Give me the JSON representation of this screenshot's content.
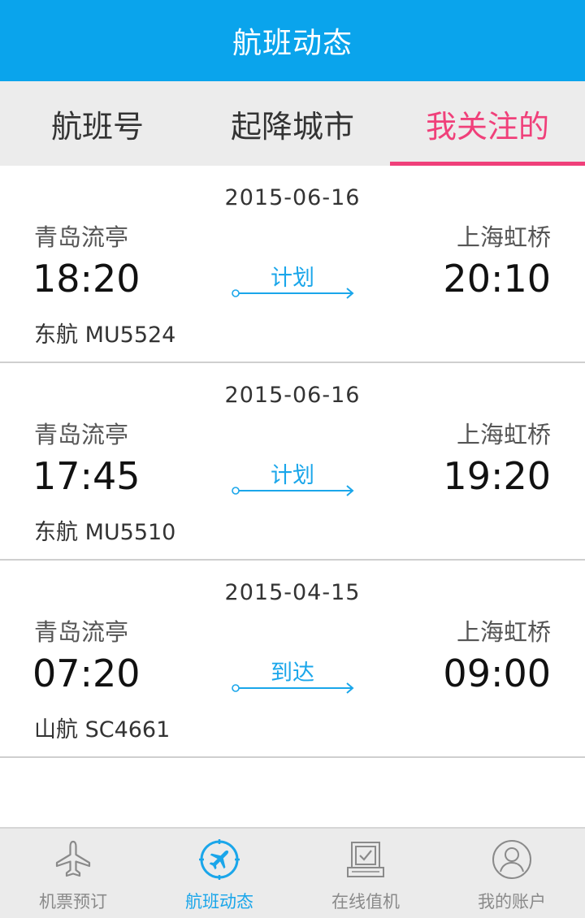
{
  "header": {
    "title": "航班动态"
  },
  "tabs": [
    {
      "label": "航班号",
      "active": false
    },
    {
      "label": "起降城市",
      "active": false
    },
    {
      "label": "我关注的",
      "active": true
    }
  ],
  "flights": [
    {
      "date": "2015-06-16",
      "from": "青岛流亭",
      "to": "上海虹桥",
      "dep": "18:20",
      "arr": "20:10",
      "status": "计划",
      "airline": "东航 MU5524"
    },
    {
      "date": "2015-06-16",
      "from": "青岛流亭",
      "to": "上海虹桥",
      "dep": "17:45",
      "arr": "19:20",
      "status": "计划",
      "airline": "东航 MU5510"
    },
    {
      "date": "2015-04-15",
      "from": "青岛流亭",
      "to": "上海虹桥",
      "dep": "07:20",
      "arr": "09:00",
      "status": "到达",
      "airline": "山航 SC4661"
    }
  ],
  "bottom_nav": [
    {
      "label": "机票预订",
      "icon": "airplane-icon",
      "active": false
    },
    {
      "label": "航班动态",
      "icon": "flight-compass-icon",
      "active": true
    },
    {
      "label": "在线值机",
      "icon": "checkin-icon",
      "active": false
    },
    {
      "label": "我的账户",
      "icon": "user-icon",
      "active": false
    }
  ],
  "colors": {
    "header_bg": "#0aa4ec",
    "active_tab": "#f0407a",
    "accent_blue": "#1aa6ea",
    "nav_inactive": "#8a8a8a"
  }
}
